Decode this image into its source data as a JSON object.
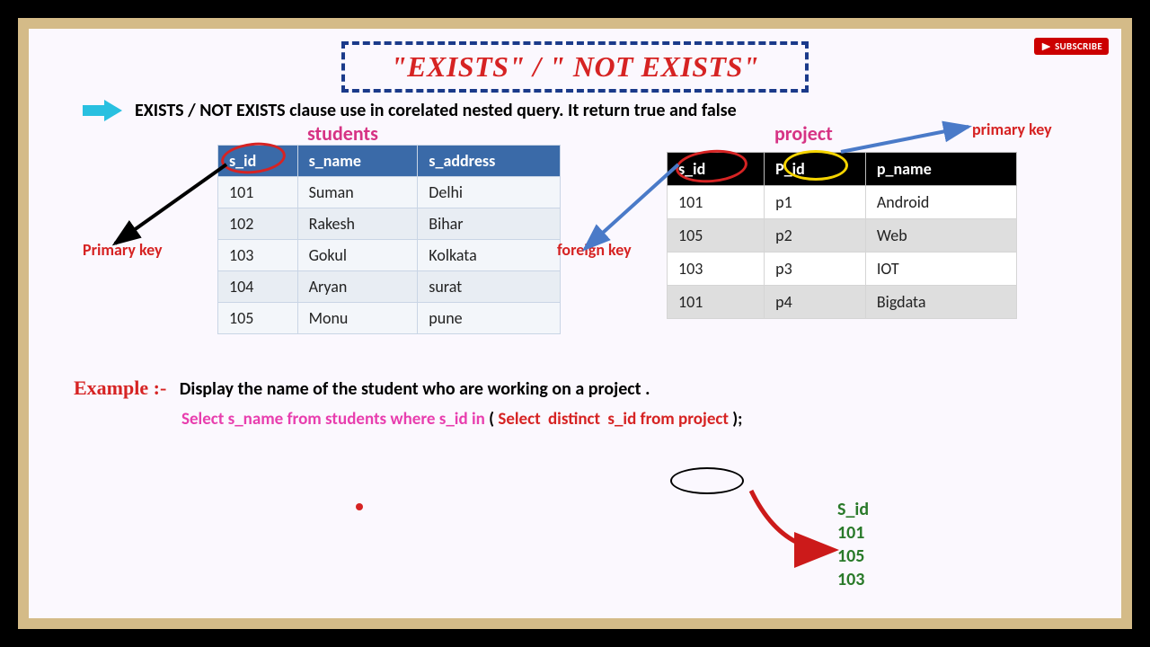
{
  "title": "\"EXISTS\"  /  \" NOT EXISTS\"",
  "subscribe": "SUBSCRIBE",
  "statement": "EXISTS / NOT EXISTS clause use in corelated nested query.  It return true and false",
  "labels": {
    "students": "students",
    "project": "project",
    "primary_key": "primary key",
    "primary_key_left": "Primary key",
    "foreign_key": "foreign key"
  },
  "students": {
    "headers": [
      "s_id",
      "s_name",
      "s_address"
    ],
    "rows": [
      [
        "101",
        "Suman",
        "Delhi"
      ],
      [
        "102",
        "Rakesh",
        "Bihar"
      ],
      [
        "103",
        "Gokul",
        "Kolkata"
      ],
      [
        "104",
        "Aryan",
        "surat"
      ],
      [
        "105",
        "Monu",
        "pune"
      ]
    ]
  },
  "project": {
    "headers": [
      "s_id",
      "P_id",
      "p_name"
    ],
    "rows": [
      [
        "101",
        "p1",
        "Android"
      ],
      [
        "105",
        "p2",
        "Web"
      ],
      [
        "103",
        "p3",
        "IOT"
      ],
      [
        "101",
        "p4",
        "Bigdata"
      ]
    ]
  },
  "example": {
    "label": "Example :-",
    "text": "Display the name of the student who are working on a project ."
  },
  "query": {
    "outer": "Select  s_name from students where s_id in",
    "open": "(",
    "inner_select": "Select",
    "inner_distinct": "distinct",
    "inner_rest": "s_id from project",
    "close": ");"
  },
  "result": [
    "S_id",
    "101",
    "105",
    "103"
  ]
}
